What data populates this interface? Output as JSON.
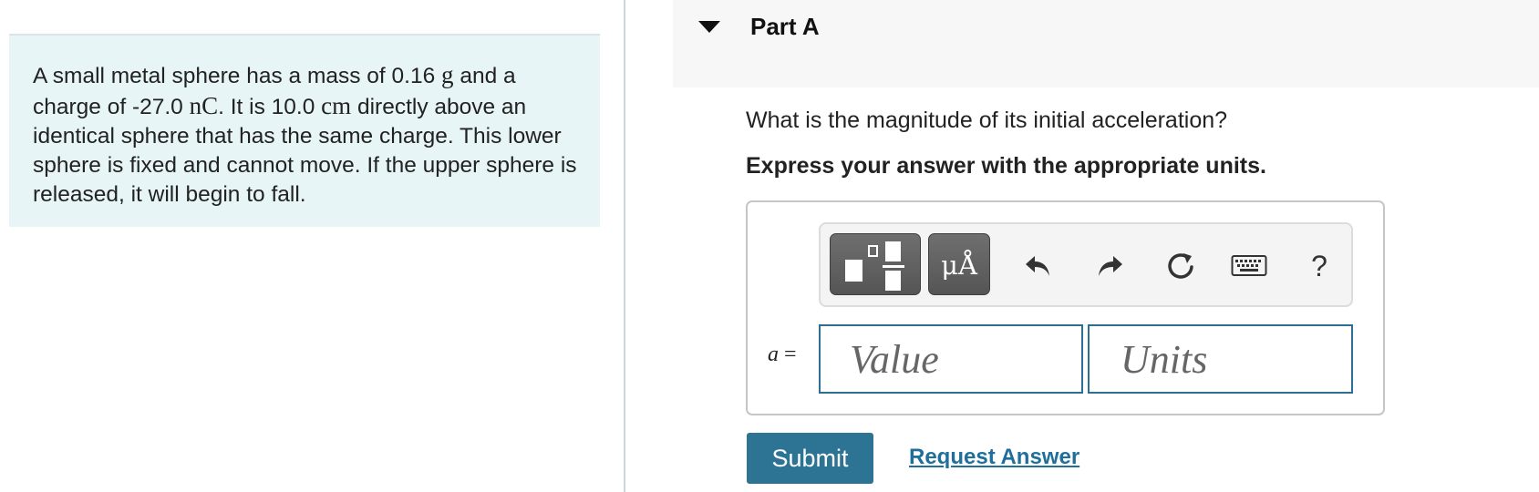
{
  "problem": {
    "segments": [
      "A small metal sphere has a mass of 0.16 ",
      "g",
      " and a charge of -27.0 ",
      "nC",
      ". It is 10.0 ",
      "cm",
      " directly above an identical sphere that has the same charge. This lower sphere is fixed and cannot move. If the upper sphere is released, it will begin to fall."
    ]
  },
  "part": {
    "title": "Part A",
    "question": "What is the magnitude of its initial acceleration?",
    "instruction": "Express your answer with the appropriate units."
  },
  "toolbar": {
    "units_label": "μÅ",
    "help_label": "?",
    "icons": [
      "templates-icon",
      "units-icon",
      "undo-icon",
      "redo-icon",
      "reset-icon",
      "keyboard-icon",
      "help-icon"
    ]
  },
  "answer": {
    "variable": "a",
    "equals": "=",
    "value_placeholder": "Value",
    "units_placeholder": "Units"
  },
  "actions": {
    "submit_label": "Submit",
    "request_label": "Request Answer"
  },
  "colors": {
    "problem_bg": "#e8f5f6",
    "accent": "#2d7394",
    "link": "#1f6f9c",
    "input_border": "#2d6f93"
  }
}
